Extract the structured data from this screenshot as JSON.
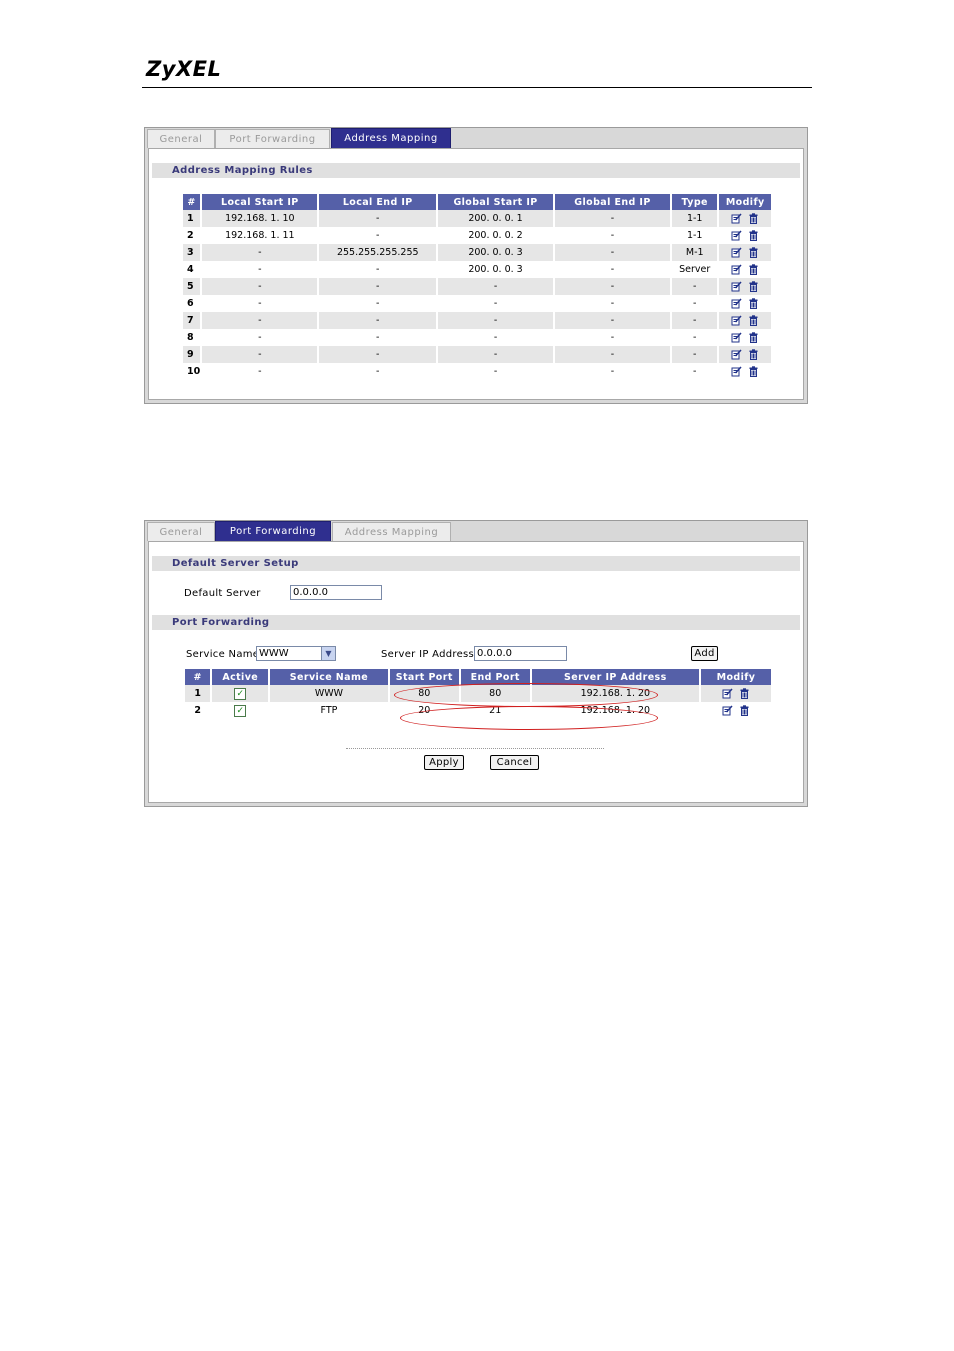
{
  "header": {
    "logo": "ZyXEL"
  },
  "address_mapping": {
    "tabs": [
      {
        "label": "General",
        "active": false
      },
      {
        "label": "Port Forwarding",
        "active": false
      },
      {
        "label": "Address Mapping",
        "active": true
      }
    ],
    "section_title": "Address Mapping Rules",
    "columns": [
      "#",
      "Local Start IP",
      "Local End IP",
      "Global Start IP",
      "Global End IP",
      "Type",
      "Modify"
    ],
    "rows": [
      {
        "num": "1",
        "local_start": "192.168. 1. 10",
        "local_end": "-",
        "global_start": "200. 0. 0. 1",
        "global_end": "-",
        "type": "1-1"
      },
      {
        "num": "2",
        "local_start": "192.168. 1. 11",
        "local_end": "-",
        "global_start": "200. 0. 0. 2",
        "global_end": "-",
        "type": "1-1"
      },
      {
        "num": "3",
        "local_start": "-",
        "local_end": "255.255.255.255",
        "global_start": "200. 0. 0. 3",
        "global_end": "-",
        "type": "M-1"
      },
      {
        "num": "4",
        "local_start": "-",
        "local_end": "-",
        "global_start": "200. 0. 0. 3",
        "global_end": "-",
        "type": "Server"
      },
      {
        "num": "5",
        "local_start": "-",
        "local_end": "-",
        "global_start": "-",
        "global_end": "-",
        "type": "-"
      },
      {
        "num": "6",
        "local_start": "-",
        "local_end": "-",
        "global_start": "-",
        "global_end": "-",
        "type": "-"
      },
      {
        "num": "7",
        "local_start": "-",
        "local_end": "-",
        "global_start": "-",
        "global_end": "-",
        "type": "-"
      },
      {
        "num": "8",
        "local_start": "-",
        "local_end": "-",
        "global_start": "-",
        "global_end": "-",
        "type": "-"
      },
      {
        "num": "9",
        "local_start": "-",
        "local_end": "-",
        "global_start": "-",
        "global_end": "-",
        "type": "-"
      },
      {
        "num": "10",
        "local_start": "-",
        "local_end": "-",
        "global_start": "-",
        "global_end": "-",
        "type": "-"
      }
    ]
  },
  "port_forwarding": {
    "tabs": [
      {
        "label": "General",
        "active": false
      },
      {
        "label": "Port Forwarding",
        "active": true
      },
      {
        "label": "Address Mapping",
        "active": false
      }
    ],
    "default_section_title": "Default Server Setup",
    "default_server_label": "Default Server",
    "default_server_value": "0.0.0.0",
    "pf_section_title": "Port Forwarding",
    "service_name_label": "Service Name",
    "service_name_value": "WWW",
    "server_ip_label": "Server IP Address",
    "server_ip_value": "0.0.0.0",
    "add_label": "Add",
    "columns": [
      "#",
      "Active",
      "Service Name",
      "Start Port",
      "End Port",
      "Server IP Address",
      "Modify"
    ],
    "rows": [
      {
        "num": "1",
        "active": true,
        "service": "WWW",
        "start": "80",
        "end": "80",
        "ip": "192.168. 1. 20"
      },
      {
        "num": "2",
        "active": true,
        "service": "FTP",
        "start": "20",
        "end": "21",
        "ip": "192.168. 1. 20"
      }
    ],
    "apply_label": "Apply",
    "cancel_label": "Cancel"
  },
  "colors": {
    "tab_active": "#2f2f8f",
    "header_row": "#5560a8",
    "annotation": "#d02020"
  }
}
